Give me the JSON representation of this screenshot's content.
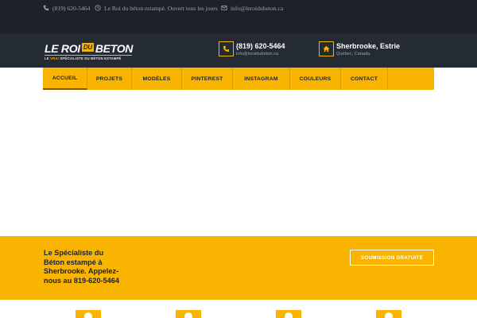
{
  "topbar": {
    "phone": "(819) 620-5464",
    "hours": "Le Roi du béton estampé. Ouvert tous les jours",
    "email": "info@leroidubeton.ca",
    "icons": {
      "phone": "phone-icon",
      "hours": "clock-icon",
      "email": "envelope-icon"
    }
  },
  "logo": {
    "part1": "LE ROI",
    "part2": "DU",
    "part3": "BETON",
    "tag_prefix": "LE",
    "tag_highlight": "VRAI",
    "tag_rest": "SPÉCIALISTE DU BÉTON ESTAMPÉ"
  },
  "contact": {
    "phone": "(819) 620-5464",
    "email": "info@leroidubeton.ca",
    "city": "Sherbrooke, Estrie",
    "region": "Québec, Canada.",
    "icons": {
      "phone": "phone-icon",
      "location": "home-icon"
    }
  },
  "nav": {
    "items": [
      {
        "label": "ACCUEIL",
        "active": true
      },
      {
        "label": "PROJETS",
        "active": false
      },
      {
        "label": "MODÈLES",
        "active": false
      },
      {
        "label": "PINTEREST",
        "active": false
      },
      {
        "label": "INSTAGRAM",
        "active": false
      },
      {
        "label": "COULEURS",
        "active": false
      },
      {
        "label": "CONTACT",
        "active": false
      }
    ]
  },
  "cta": {
    "line1": "Le Spécialiste du",
    "line2": "Béton estampé à",
    "line3": "Sherbrooke. Appelez-",
    "line4": "nous au 819-620-5464",
    "button": "SOUMISSION GRATUITE"
  },
  "colors": {
    "accent": "#f8b400",
    "topbar_bg": "#1d222a",
    "header_bg": "#252b33",
    "text_dark": "#1d222a"
  }
}
